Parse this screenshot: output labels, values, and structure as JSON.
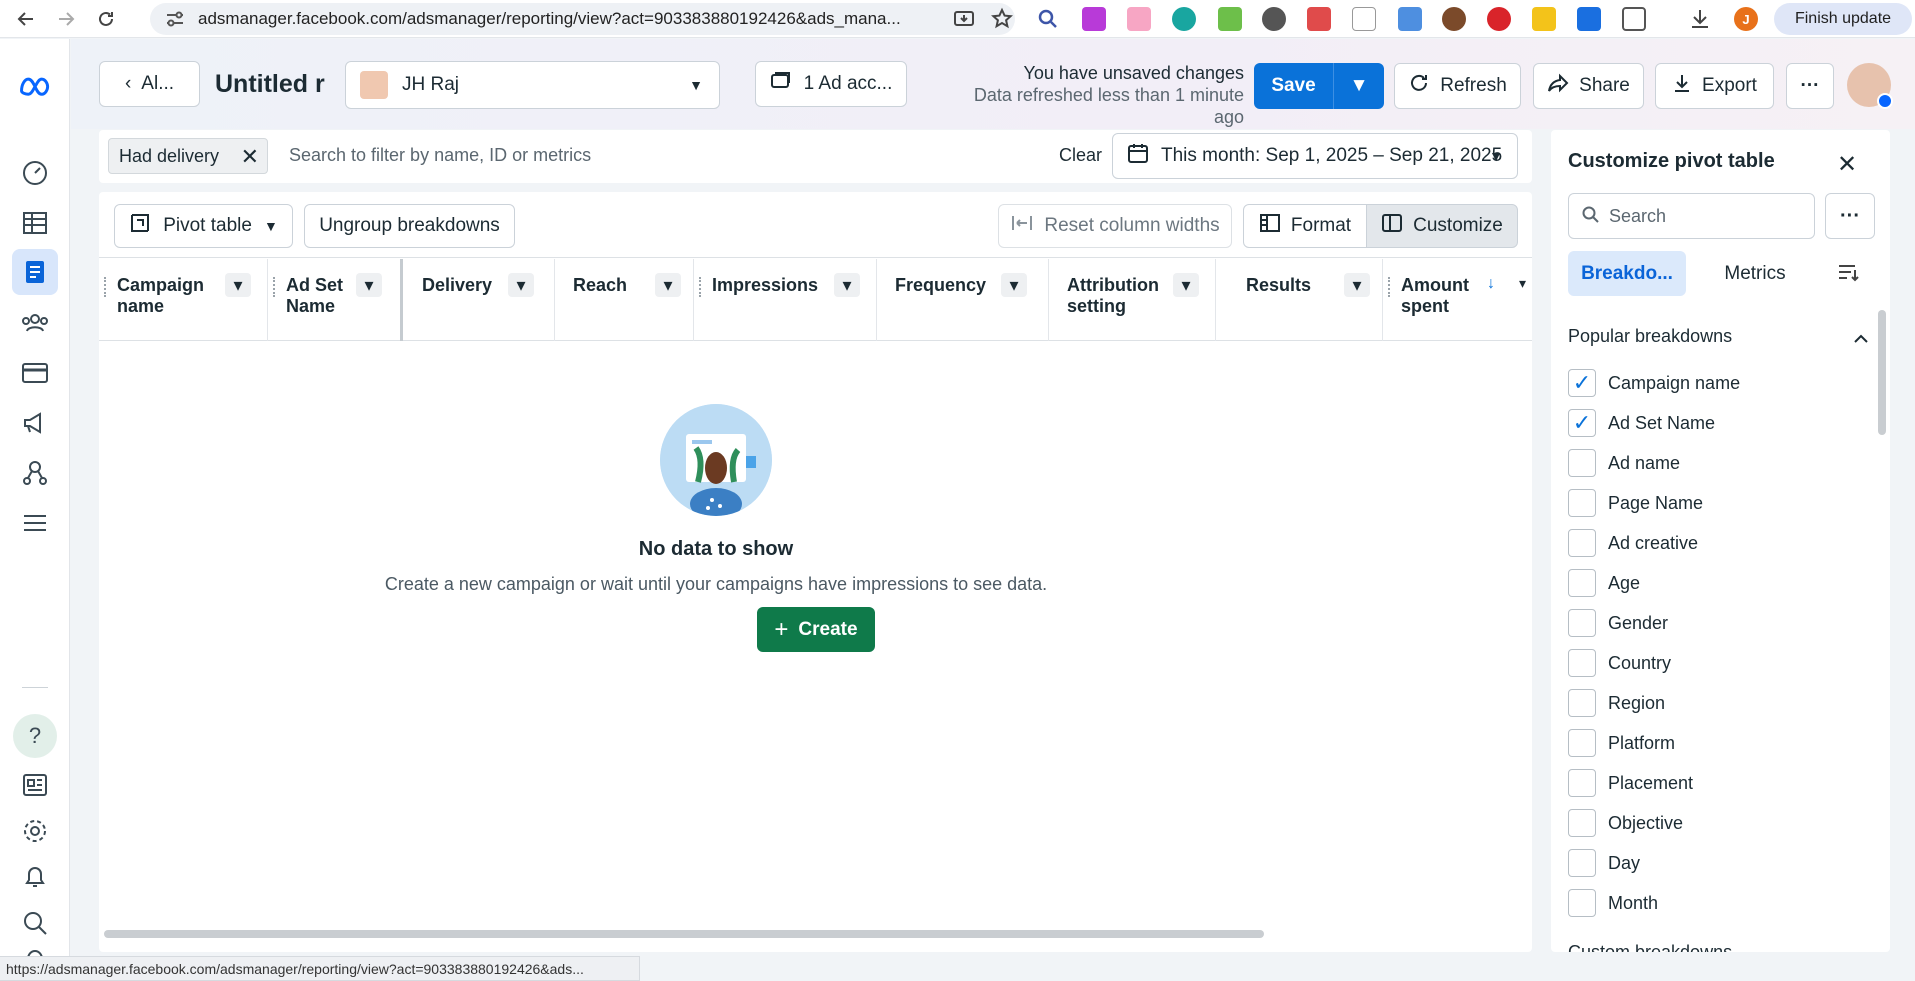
{
  "browser": {
    "url": "adsmanager.facebook.com/adsmanager/reporting/view?act=903383880192426&ads_mana...",
    "finish_update": "Finish update",
    "profile_initial": "J"
  },
  "header": {
    "back_label": "Al...",
    "report_title": "Untitled r",
    "account_name": "JH Raj",
    "ad_accounts_label": "1 Ad acc...",
    "unsaved_text": "You have unsaved changes",
    "refreshed_text": "Data refreshed less than 1 minute ago",
    "save_label": "Save",
    "refresh_label": "Refresh",
    "share_label": "Share",
    "export_label": "Export"
  },
  "filter": {
    "chip_label": "Had delivery",
    "placeholder": "Search to filter by name, ID or metrics",
    "clear_label": "Clear",
    "date_range": "This month: Sep 1, 2025 – Sep 21, 2025"
  },
  "toolbar": {
    "view_label": "Pivot table",
    "ungroup_label": "Ungroup breakdowns",
    "reset_widths_label": "Reset column widths",
    "format_label": "Format",
    "customize_label": "Customize"
  },
  "columns": [
    {
      "label": "Campaign name"
    },
    {
      "label": "Ad Set Name"
    },
    {
      "label": "Delivery"
    },
    {
      "label": "Reach"
    },
    {
      "label": "Impressions"
    },
    {
      "label": "Frequency"
    },
    {
      "label": "Attribution setting"
    },
    {
      "label": "Results"
    },
    {
      "label": "Amount spent"
    }
  ],
  "empty_state": {
    "title": "No data to show",
    "subtitle": "Create a new campaign or wait until your campaigns have impressions to see data.",
    "create_label": "Create"
  },
  "panel": {
    "title": "Customize pivot table",
    "search_placeholder": "Search",
    "tab_breakdowns": "Breakdo...",
    "tab_metrics": "Metrics",
    "section_title": "Popular breakdowns",
    "next_section_partial": "Custom breakdowns",
    "breakdowns": [
      {
        "label": "Campaign name",
        "checked": true
      },
      {
        "label": "Ad Set Name",
        "checked": true
      },
      {
        "label": "Ad name",
        "checked": false
      },
      {
        "label": "Page Name",
        "checked": false
      },
      {
        "label": "Ad creative",
        "checked": false
      },
      {
        "label": "Age",
        "checked": false
      },
      {
        "label": "Gender",
        "checked": false
      },
      {
        "label": "Country",
        "checked": false
      },
      {
        "label": "Region",
        "checked": false
      },
      {
        "label": "Platform",
        "checked": false
      },
      {
        "label": "Placement",
        "checked": false
      },
      {
        "label": "Objective",
        "checked": false
      },
      {
        "label": "Day",
        "checked": false
      },
      {
        "label": "Month",
        "checked": false
      }
    ]
  },
  "status_url": "https://adsmanager.facebook.com/adsmanager/reporting/view?act=903383880192426&ads...",
  "colors": {
    "primary": "#0a72d9",
    "create_green": "#0f7a4a",
    "active_tab_bg": "#dbe9fb"
  }
}
